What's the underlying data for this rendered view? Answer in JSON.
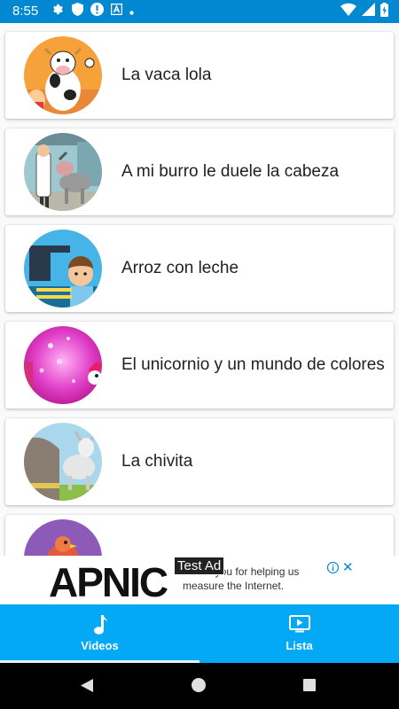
{
  "status_bar": {
    "time": "8:55",
    "left_icons": [
      "gear-icon",
      "shield-icon",
      "alert-icon",
      "a-box-icon",
      "dot-icon"
    ],
    "right_icons": [
      "wifi-icon",
      "signal-icon",
      "battery-icon"
    ]
  },
  "songs": [
    {
      "title": "La vaca lola",
      "thumb": "cow-thumbnail"
    },
    {
      "title": "A mi burro le duele la cabeza",
      "thumb": "donkey-doctor-thumbnail"
    },
    {
      "title": "Arroz con leche",
      "thumb": "sewing-boy-thumbnail"
    },
    {
      "title": "El unicornio y un mundo de colores",
      "thumb": "pink-unicorn-thumbnail"
    },
    {
      "title": "La chivita",
      "thumb": "goat-thumbnail"
    },
    {
      "title": "",
      "thumb": "bird-thumbnail"
    }
  ],
  "ad": {
    "logo": "APNIC",
    "label": "Test Ad",
    "text": "Thank you for helping us measure the Internet."
  },
  "bottom_nav": {
    "tabs": [
      {
        "label": "Videos",
        "icon": "music-note-icon",
        "active": true
      },
      {
        "label": "Lista",
        "icon": "play-screen-icon",
        "active": false
      }
    ]
  },
  "colors": {
    "status_bar": "#0288d1",
    "bottom_nav": "#03a9f4",
    "card_background": "#ffffff",
    "text": "#212121"
  }
}
